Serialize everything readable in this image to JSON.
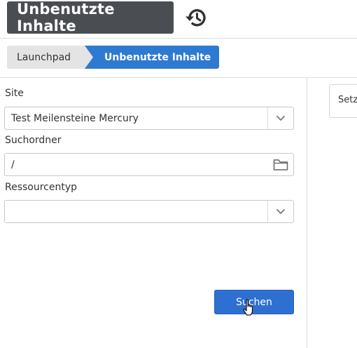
{
  "header": {
    "title": "Unbenutzte Inhalte",
    "history_icon": "history-icon"
  },
  "breadcrumb": {
    "items": [
      {
        "label": "Launchpad"
      },
      {
        "label": "Unbenutzte Inhalte"
      }
    ]
  },
  "form": {
    "site": {
      "label": "Site",
      "value": "Test Meilensteine Mercury",
      "icon": "chevron-down-icon"
    },
    "folder": {
      "label": "Suchordner",
      "value": "/",
      "icon": "folder-icon"
    },
    "resource_type": {
      "label": "Ressourcentyp",
      "value": "",
      "icon": "chevron-down-icon"
    },
    "search_label": "Suchen"
  },
  "right_panel": {
    "text": "Setz"
  },
  "colors": {
    "accent": "#2e7ad1",
    "button": "#2e6fd2",
    "title_bg": "#4a4d52"
  }
}
